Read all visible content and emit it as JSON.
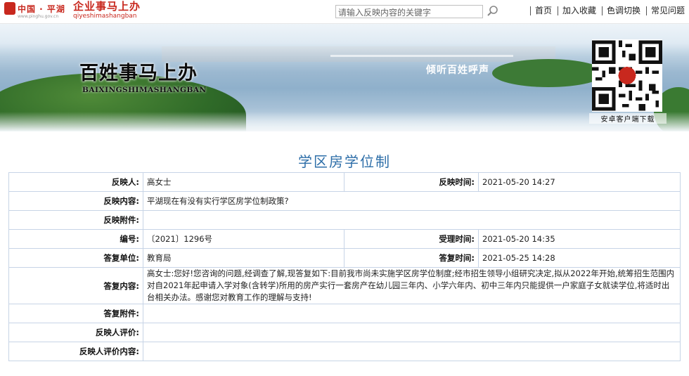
{
  "header": {
    "logo1_text": "中国 · 平湖",
    "logo1_url": "www.pinghu.gov.cn",
    "logo2_text": "企业事马上办",
    "logo2_pinyin": "qiyeshimashangban",
    "search_placeholder": "请输入反映内容的关键字",
    "nav": [
      "首页",
      "加入收藏",
      "色调切换",
      "常见问题"
    ]
  },
  "banner": {
    "title": "百姓事马上办",
    "pinyin": "BAIXINGSHIMASHANGBAN",
    "slogan": "倾听百姓呼声",
    "qr_caption": "安卓客户端下载"
  },
  "page_title": "学区房学位制",
  "record": {
    "reporter_label": "反映人:",
    "reporter": "高女士",
    "report_time_label": "反映时间:",
    "report_time": "2021-05-20 14:27",
    "content_label": "反映内容:",
    "content": "平湖现在有没有实行学区房学位制政策?",
    "attachment_label": "反映附件:",
    "attachment": "",
    "number_label": "编号:",
    "number": "〔2021〕1296号",
    "accept_time_label": "受理时间:",
    "accept_time": "2021-05-20 14:35",
    "unit_label": "答复单位:",
    "unit": "教育局",
    "reply_time_label": "答复时间:",
    "reply_time": "2021-05-25 14:28",
    "reply_label": "答复内容:",
    "reply": "高女士:您好!您咨询的问题,经调查了解,现答复如下:目前我市尚未实施学区房学位制度;经市招生领导小组研究决定,拟从2022年开始,统筹招生范围内对自2021年起申请入学对象(含转学)所用的房产实行一套房产在幼儿园三年内、小学六年内、初中三年内只能提供一户家庭子女就读学位,将适时出台相关办法。感谢您对教育工作的理解与支持!",
    "reply_attachment_label": "答复附件:",
    "reply_attachment": "",
    "evaluation_label": "反映人评价:",
    "evaluation": "",
    "evaluation_content_label": "反映人评价内容:",
    "evaluation_content": ""
  },
  "colors": {
    "brand_red": "#c8281e",
    "title_blue": "#2d6ea8",
    "table_border": "#c7d4e6"
  }
}
